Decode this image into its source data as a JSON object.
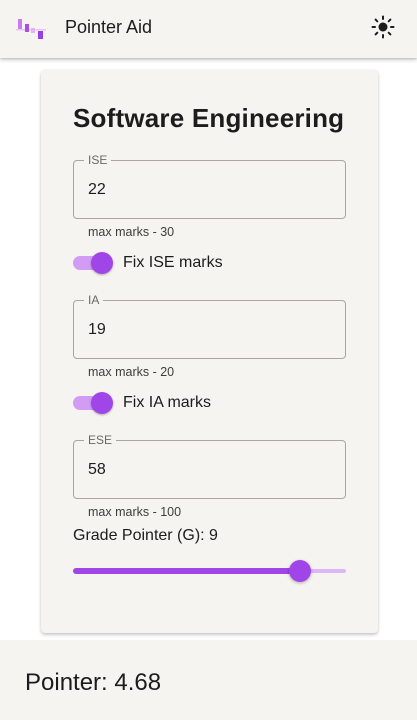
{
  "app": {
    "title": "Pointer Aid",
    "theme_toggle_icon": "sun-icon",
    "logo_icon": "bars-logo-icon",
    "accent_color": "#a046e8"
  },
  "card": {
    "title": "Software Engineering",
    "fields": [
      {
        "label": "ISE",
        "value": "22",
        "helper": "max marks - 30"
      },
      {
        "label": "IA",
        "value": "19",
        "helper": "max marks - 20"
      },
      {
        "label": "ESE",
        "value": "58",
        "helper": "max marks - 100"
      }
    ],
    "switches": [
      {
        "label": "Fix ISE marks",
        "checked": true
      },
      {
        "label": "Fix IA marks",
        "checked": true
      }
    ],
    "grade": {
      "label": "Grade Pointer (G): 9",
      "slider_fraction": 0.83
    }
  },
  "footer": {
    "text": "Pointer: 4.68"
  }
}
